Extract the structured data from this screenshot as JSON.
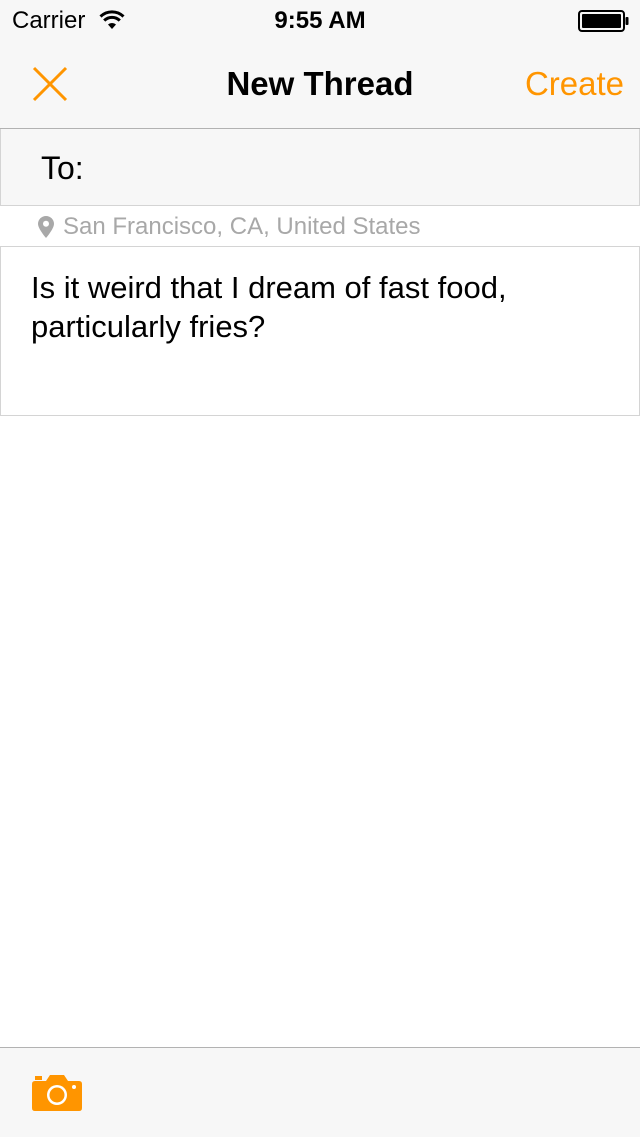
{
  "status_bar": {
    "carrier": "Carrier",
    "time": "9:55 AM",
    "wifi_icon": "wifi-icon",
    "battery_icon": "battery-icon"
  },
  "nav_bar": {
    "close_icon": "close-icon",
    "title": "New Thread",
    "create_label": "Create"
  },
  "to_field": {
    "label": "To:",
    "value": ""
  },
  "location": {
    "icon": "location-pin-icon",
    "text": "San Francisco, CA, United States"
  },
  "message": {
    "text": "Is it weird that I dream of fast food, particularly fries?"
  },
  "toolbar": {
    "camera_icon": "camera-icon"
  },
  "colors": {
    "accent": "#ff9500",
    "bar_background": "#f7f7f7",
    "separator": "#b2b2b2",
    "secondary_text": "#a8a8a8"
  }
}
